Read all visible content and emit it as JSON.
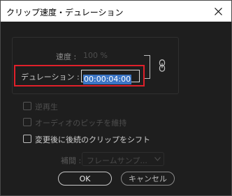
{
  "window": {
    "title": "クリップ速度・デュレーション"
  },
  "speed": {
    "label": "速度 :",
    "value": "100 %"
  },
  "duration": {
    "label": "デュレーション :",
    "value": "00:00:04:00"
  },
  "options": {
    "reverse": {
      "label": "逆再生",
      "checked": false,
      "enabled": false
    },
    "maintain_pitch": {
      "label": "オーディオのピッチを維持",
      "checked": false,
      "enabled": false
    },
    "ripple_edit": {
      "label": "変更後に後続のクリップをシフト",
      "checked": false,
      "enabled": true
    }
  },
  "interpolation": {
    "label": "補間 :",
    "value": "フレームサンプ...",
    "enabled": false
  },
  "buttons": {
    "ok": "OK",
    "cancel": "キャンセル"
  },
  "colors": {
    "highlight_border": "#e0202a",
    "selection": "#3a74c4",
    "background": "#1e1e1e"
  },
  "icons": {
    "close": "close-icon",
    "link": "link-icon",
    "chevron": "chevron-down-icon"
  }
}
